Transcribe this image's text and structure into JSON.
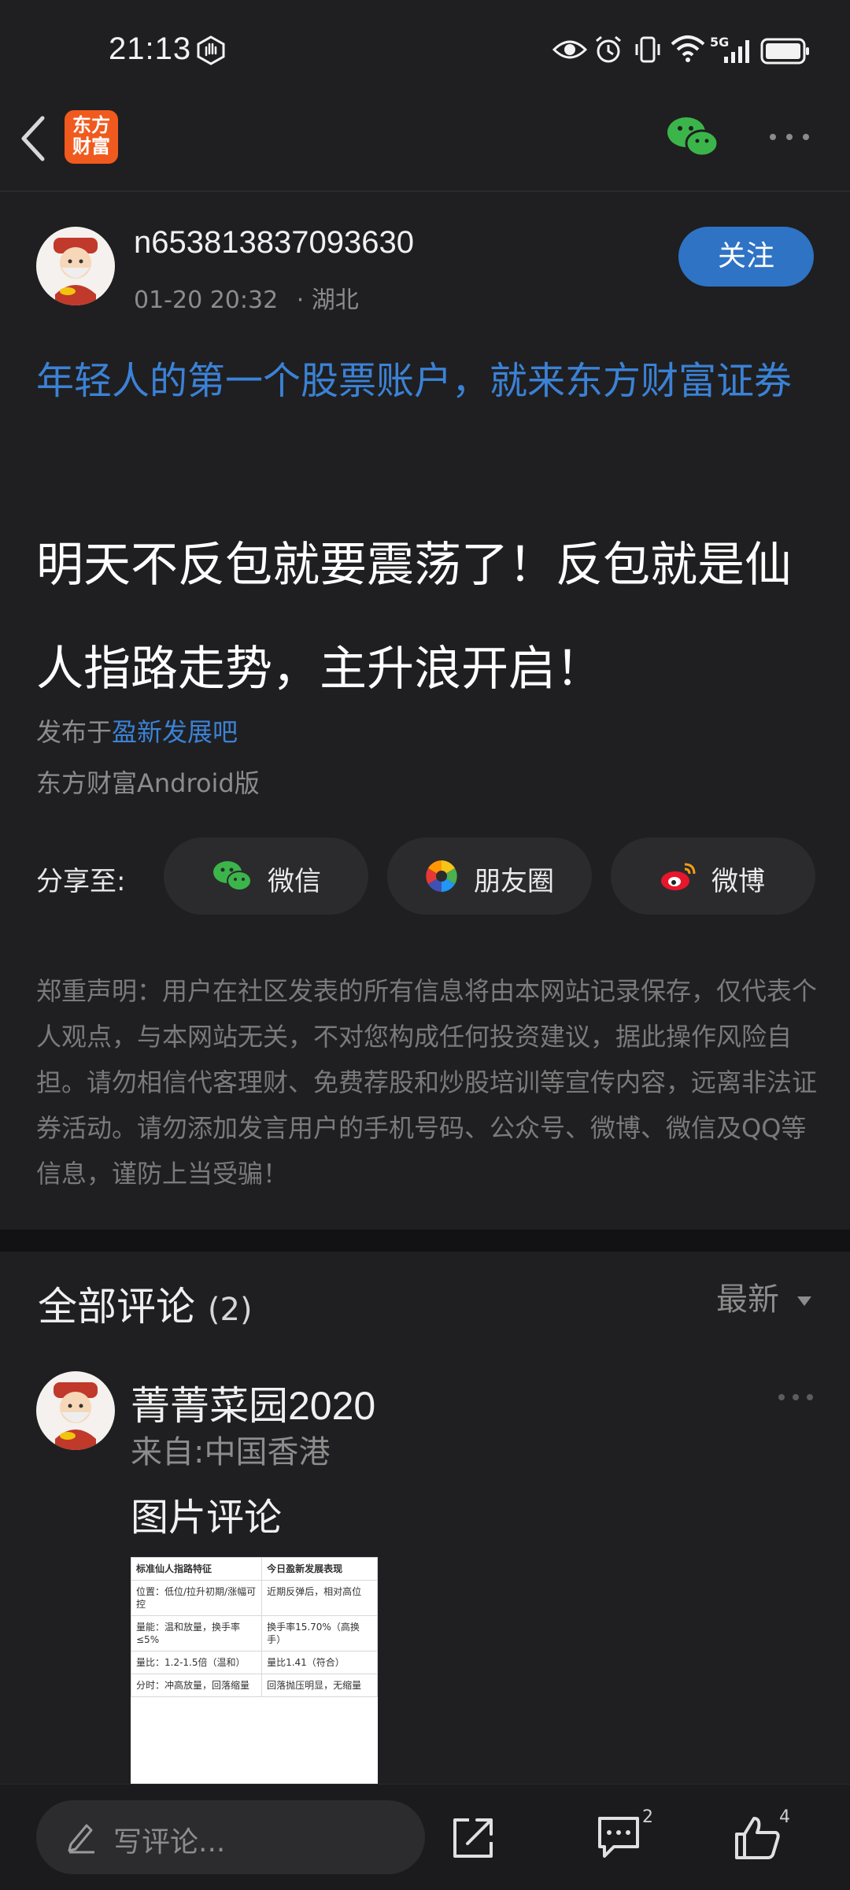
{
  "status_bar": {
    "time": "21:13",
    "icons": [
      "hand-icon",
      "eye-icon",
      "alarm-icon",
      "vibrate-icon",
      "wifi-icon",
      "signal-5g-icon",
      "battery-icon"
    ],
    "network_label": "5G"
  },
  "nav": {
    "logo_text_line1": "东方",
    "logo_text_line2": "财富",
    "logo_color": "#f05a1e"
  },
  "post": {
    "author": "n653813837093630",
    "date": "01-20 20:32",
    "location": "· 湖北",
    "follow_label": "关注",
    "ad_text": "年轻人的第一个股票账户，就来东方财富证券",
    "title": "明天不反包就要震荡了！反包就是仙人指路走势，主升浪开启！",
    "published_prefix": "发布于",
    "bar_name": "盈新发展吧",
    "client": "东方财富Android版"
  },
  "share": {
    "label": "分享至:",
    "buttons": [
      {
        "label": "微信",
        "icon": "wechat-icon"
      },
      {
        "label": "朋友圈",
        "icon": "moments-icon"
      },
      {
        "label": "微博",
        "icon": "weibo-icon"
      }
    ]
  },
  "disclaimer": "郑重声明：用户在社区发表的所有信息将由本网站记录保存，仅代表个人观点，与本网站无关，不对您构成任何投资建议，据此操作风险自担。请勿相信代客理财、免费荐股和炒股培训等宣传内容，远离非法证券活动。请勿添加发言用户的手机号码、公众号、微博、微信及QQ等信息，谨防上当受骗！",
  "comments": {
    "title": "全部评论",
    "count": "(2)",
    "sort_label": "最新",
    "items": [
      {
        "name": "菁菁菜园2020",
        "location": "来自:中国香港",
        "text": "图片评论",
        "image_table": {
          "headers": [
            "标准仙人指路特征",
            "今日盈新发展表现"
          ],
          "rows": [
            [
              "位置：低位/拉升初期/涨幅可控",
              "近期反弹后，相对高位"
            ],
            [
              "量能：温和放量，换手率≤5%",
              "换手率15.70%（高换手）"
            ],
            [
              "量比：1.2-1.5倍（温和）",
              "量比1.41（符合）"
            ],
            [
              "分时：冲高放量，回落缩量",
              "回落抛压明显，无缩量"
            ]
          ]
        }
      }
    ]
  },
  "bottom_bar": {
    "input_placeholder": "写评论...",
    "comment_count": "2",
    "like_count": "4"
  },
  "colors": {
    "background": "#1f1f21",
    "accent_blue": "#3b82d6",
    "follow_button": "#2f73c5",
    "wechat_green": "#3bb54a"
  }
}
